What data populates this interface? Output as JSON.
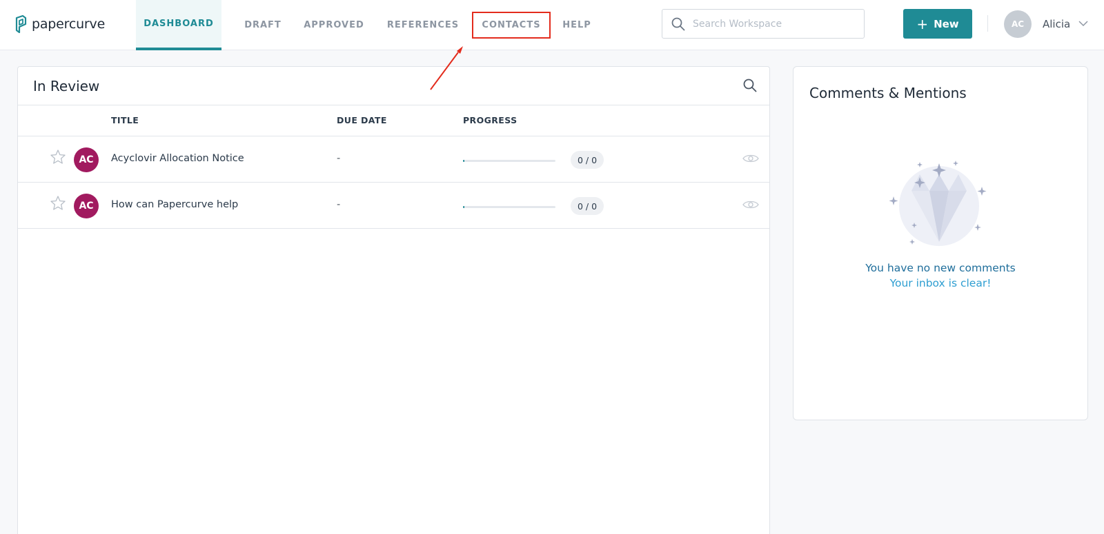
{
  "app": {
    "logo_text": "papercurve",
    "brand_color": "#1f8b95"
  },
  "nav": {
    "tabs": [
      {
        "label": "DASHBOARD",
        "active": true
      },
      {
        "label": "DRAFT",
        "active": false
      },
      {
        "label": "APPROVED",
        "active": false
      },
      {
        "label": "REFERENCES",
        "active": false
      },
      {
        "label": "CONTACTS",
        "active": false,
        "highlighted": true
      },
      {
        "label": "HELP",
        "active": false
      }
    ],
    "search": {
      "placeholder": "Search Workspace",
      "value": "",
      "icon": "search-icon"
    },
    "new_button": {
      "label": "New",
      "icon": "plus-icon"
    },
    "user": {
      "initials": "AC",
      "name": "Alicia",
      "icon": "chevron-down-icon"
    }
  },
  "review": {
    "title": "In Review",
    "columns": {
      "title": "TITLE",
      "due_date": "DUE DATE",
      "progress": "PROGRESS"
    },
    "rows": [
      {
        "starred": false,
        "owner_initials": "AC",
        "title": "Acyclovir Allocation Notice",
        "due_date": "-",
        "progress_fraction": 0,
        "progress_label": "0 / 0"
      },
      {
        "starred": false,
        "owner_initials": "AC",
        "title": "How can Papercurve help",
        "due_date": "-",
        "progress_fraction": 0,
        "progress_label": "0 / 0"
      }
    ]
  },
  "comments": {
    "title": "Comments & Mentions",
    "empty_line1": "You have no new comments",
    "empty_line2": "Your inbox is clear!",
    "illustration": "diamond-sparkle-illustration"
  },
  "annotation": {
    "type": "arrow",
    "color": "#e32b1c",
    "target": "tab-contacts"
  }
}
